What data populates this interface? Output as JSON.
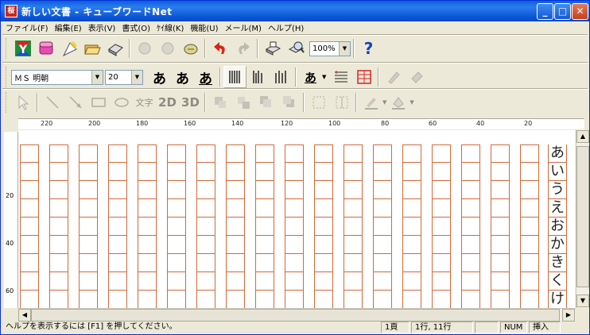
{
  "window": {
    "title": "新しい文書 - キューブワードNet",
    "app_icon": "桜"
  },
  "menu": [
    "ファイル(F)",
    "編集(E)",
    "表示(V)",
    "書式(O)",
    "ｹｲ線(K)",
    "機能(U)",
    "メール(M)",
    "ヘルプ(H)"
  ],
  "toolbar1": {
    "zoom": "100%"
  },
  "toolbar2": {
    "font_name": "ＭＳ 明朝",
    "font_size": "20",
    "style_a1": "あ",
    "style_a2": "あ",
    "style_a3": "あ",
    "color_a": "あ"
  },
  "toolbar3": {
    "text_tool": "文字",
    "t2d": "2D",
    "t3d": "3D"
  },
  "ruler": {
    "top_labels": [
      "220",
      "200",
      "180",
      "160",
      "140",
      "120",
      "100",
      "80",
      "60",
      "40",
      "20"
    ],
    "left_labels": [
      "20",
      "40",
      "60"
    ]
  },
  "document": {
    "column_chars": [
      "あ",
      "い",
      "う",
      "え",
      "お",
      "か",
      "き",
      "く",
      "け"
    ]
  },
  "status": {
    "help": "ヘルプを表示するには [F1] を押してください。",
    "page": "1頁",
    "position": "1行, 11行",
    "num": "NUM",
    "insert": "挿入"
  },
  "colors": {
    "grid": "#d26a3a",
    "titlebar": "#0a5fd8"
  }
}
